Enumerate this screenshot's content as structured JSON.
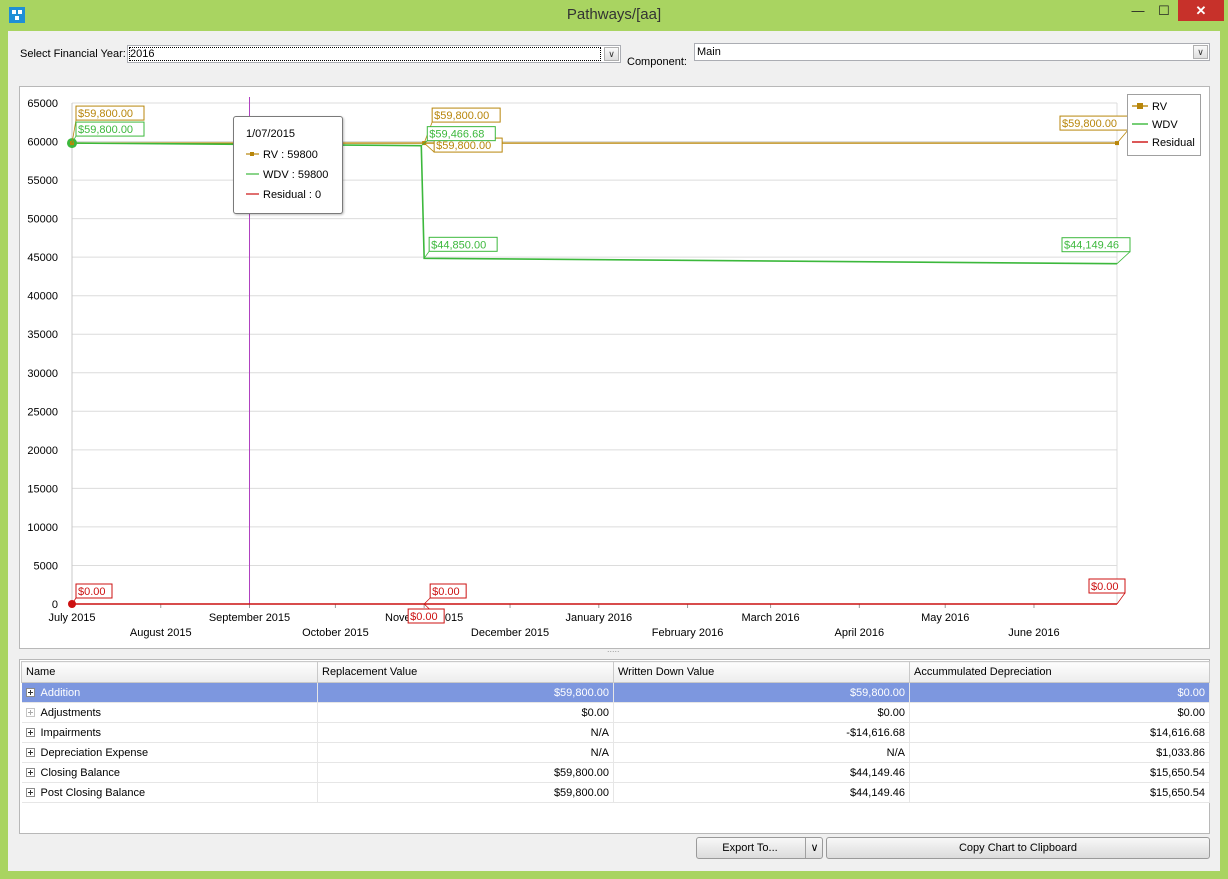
{
  "window": {
    "title": "Pathways/[aa]",
    "min_glyph": "—",
    "max_glyph": "☐",
    "close_glyph": "✕"
  },
  "filters": {
    "year_label": "Select Financial Year:",
    "year_value": "2016",
    "component_label": "Component:",
    "component_value": "Main"
  },
  "chart_data": {
    "type": "line",
    "y_ticks": [
      "0",
      "5000",
      "10000",
      "15000",
      "20000",
      "25000",
      "30000",
      "35000",
      "40000",
      "45000",
      "50000",
      "55000",
      "60000",
      "65000"
    ],
    "ylim": [
      0,
      65000
    ],
    "x_ticks_upper": [
      "July 2015",
      "September 2015",
      "November 2015",
      "January 2016",
      "March 2016",
      "May 2016"
    ],
    "x_ticks_lower": [
      "August 2015",
      "October 2015",
      "December 2015",
      "February 2016",
      "April 2016",
      "June 2016"
    ],
    "x_range": [
      "2015-07-01",
      "2016-06-30"
    ],
    "grid": true,
    "legend_position": "top-right",
    "series": [
      {
        "name": "RV",
        "color": "#b8860b",
        "points": [
          {
            "x": "2015-07-01",
            "y": 59800
          },
          {
            "x": "2015-11-01",
            "y": 59800
          },
          {
            "x": "2016-06-30",
            "y": 59800
          }
        ],
        "labels": [
          {
            "x": "2015-07-01",
            "y": 59800,
            "text": "$59,800.00"
          },
          {
            "x": "2015-11-01",
            "y": 59800,
            "text": "$59,800.00"
          },
          {
            "x": "2015-11-01",
            "y": 59800,
            "text": "$59,800.00"
          },
          {
            "x": "2016-06-30",
            "y": 59800,
            "text": "$59,800.00"
          }
        ]
      },
      {
        "name": "WDV",
        "color": "#3cb83c",
        "points": [
          {
            "x": "2015-07-01",
            "y": 59800
          },
          {
            "x": "2015-10-31",
            "y": 59466.68
          },
          {
            "x": "2015-11-01",
            "y": 44850
          },
          {
            "x": "2016-06-30",
            "y": 44149.46
          }
        ],
        "labels": [
          {
            "x": "2015-07-01",
            "y": 59800,
            "text": "$59,800.00"
          },
          {
            "x": "2015-10-31",
            "y": 59466.68,
            "text": "$59,466.68"
          },
          {
            "x": "2015-11-01",
            "y": 44850,
            "text": "$44,850.00"
          },
          {
            "x": "2016-06-30",
            "y": 44149.46,
            "text": "$44,149.46"
          }
        ]
      },
      {
        "name": "Residual",
        "color": "#cc1111",
        "points": [
          {
            "x": "2015-07-01",
            "y": 0
          },
          {
            "x": "2015-11-01",
            "y": 0
          },
          {
            "x": "2016-06-30",
            "y": 0
          }
        ],
        "labels": [
          {
            "x": "2015-07-01",
            "y": 0,
            "text": "$0.00"
          },
          {
            "x": "2015-11-01",
            "y": 0,
            "text": "$0.00"
          },
          {
            "x": "2015-11-01",
            "y": 0,
            "text": "$0.00"
          },
          {
            "x": "2016-06-30",
            "y": 0,
            "text": "$0.00"
          }
        ]
      }
    ],
    "cursor_date": "2015-09-01",
    "tooltip": {
      "date": "1/07/2015",
      "rows": [
        "RV : 59800",
        "WDV : 59800",
        "Residual : 0"
      ]
    }
  },
  "table": {
    "columns": [
      "Name",
      "Replacement Value",
      "Written Down Value",
      "Accummulated Depreciation"
    ],
    "rows": [
      {
        "name": "Addition",
        "rv": "$59,800.00",
        "wdv": "$59,800.00",
        "ad": "$0.00",
        "selected": true
      },
      {
        "name": "Adjustments",
        "rv": "$0.00",
        "wdv": "$0.00",
        "ad": "$0.00"
      },
      {
        "name": "Impairments",
        "rv": "N/A",
        "wdv": "-$14,616.68",
        "ad": "$14,616.68"
      },
      {
        "name": "Depreciation Expense",
        "rv": "N/A",
        "wdv": "N/A",
        "ad": "$1,033.86"
      },
      {
        "name": "Closing Balance",
        "rv": "$59,800.00",
        "wdv": "$44,149.46",
        "ad": "$15,650.54"
      },
      {
        "name": "Post Closing Balance",
        "rv": "$59,800.00",
        "wdv": "$44,149.46",
        "ad": "$15,650.54"
      }
    ]
  },
  "buttons": {
    "export_label": "Export To...",
    "copy_label": "Copy Chart to Clipboard",
    "dropdown_glyph": "∨"
  }
}
